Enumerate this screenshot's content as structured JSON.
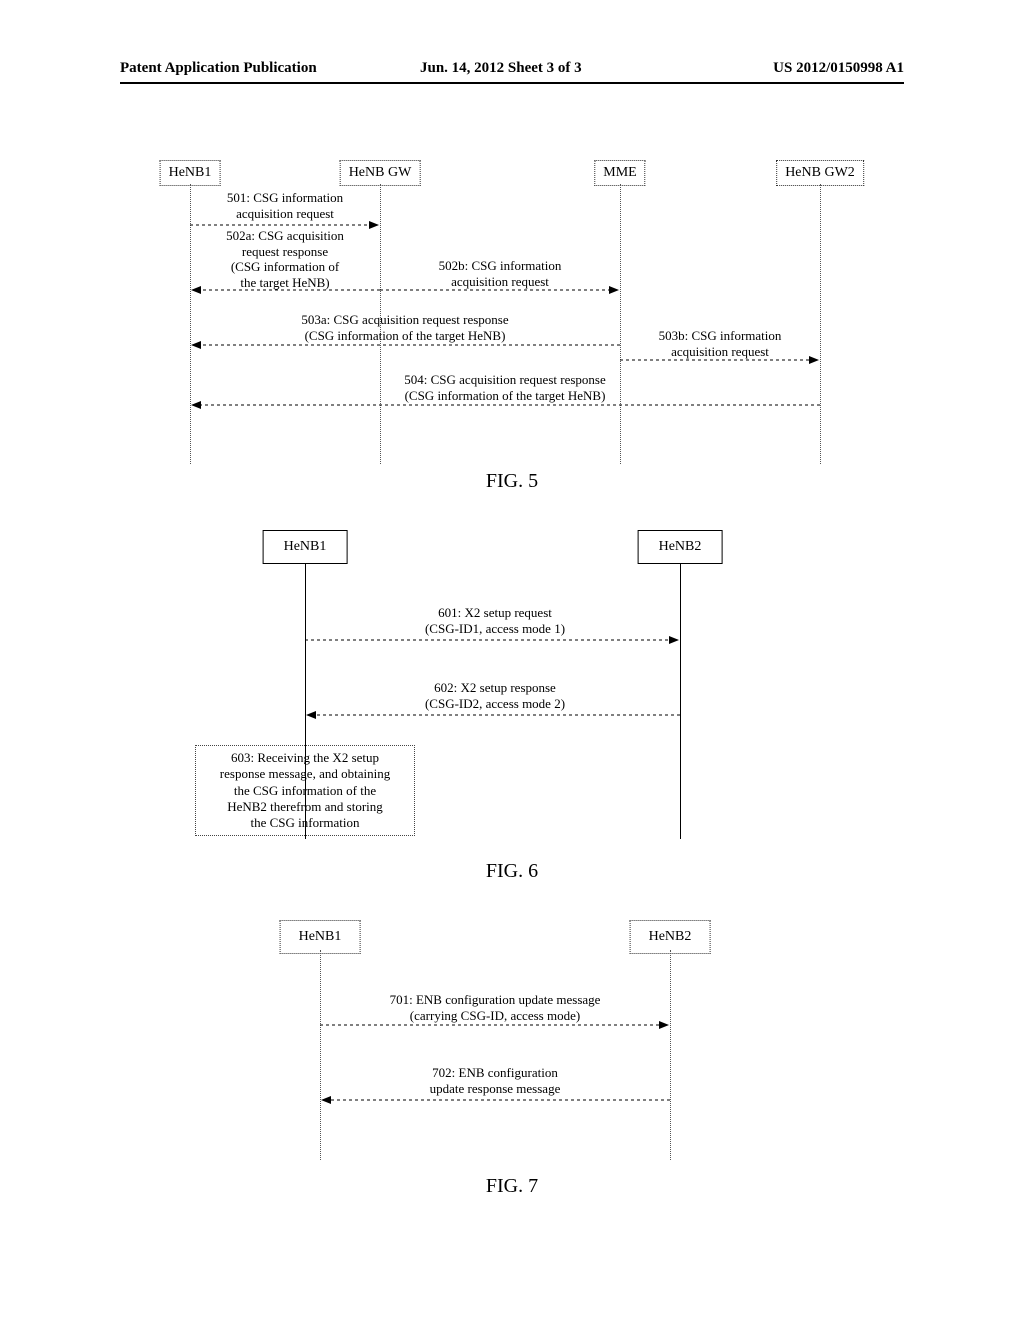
{
  "header": {
    "left": "Patent Application Publication",
    "mid": "Jun. 14, 2012  Sheet 3 of 3",
    "right": "US 2012/0150998 A1"
  },
  "fig5": {
    "nodes": {
      "a": "HeNB1",
      "b": "HeNB GW",
      "c": "MME",
      "d": "HeNB GW2"
    },
    "msgs": {
      "m501": "501:  CSG information",
      "m501b": "acquisition request",
      "m502a": "502a:  CSG acquisition",
      "m502a2": "request response",
      "m502a3": "(CSG information of",
      "m502a4": "the target HeNB)",
      "m502b": "502b:  CSG information",
      "m502b2": "acquisition request",
      "m503a": "503a:  CSG acquisition request response",
      "m503a2": "(CSG information of the target HeNB)",
      "m503b": "503b:  CSG information",
      "m503b2": "acquisition request",
      "m504": "504:  CSG acquisition request response",
      "m504b": "(CSG information of the target HeNB)"
    },
    "label": "FIG. 5"
  },
  "fig6": {
    "nodes": {
      "a": "HeNB1",
      "b": "HeNB2"
    },
    "msgs": {
      "m601": "601:  X2 setup request",
      "m601b": "(CSG-ID1, access mode 1)",
      "m602": "602:  X2 setup response",
      "m602b": "(CSG-ID2, access mode 2)",
      "m603a": "603:  Receiving the X2 setup",
      "m603b": "response message, and obtaining",
      "m603c": "the CSG information of the",
      "m603d": "HeNB2 therefrom and storing",
      "m603e": "the CSG information"
    },
    "label": "FIG. 6"
  },
  "fig7": {
    "nodes": {
      "a": "HeNB1",
      "b": "HeNB2"
    },
    "msgs": {
      "m701": "701:  ENB configuration update message",
      "m701b": "(carrying CSG-ID, access mode)",
      "m702": "702:  ENB configuration",
      "m702b": "update response message"
    },
    "label": "FIG. 7"
  }
}
